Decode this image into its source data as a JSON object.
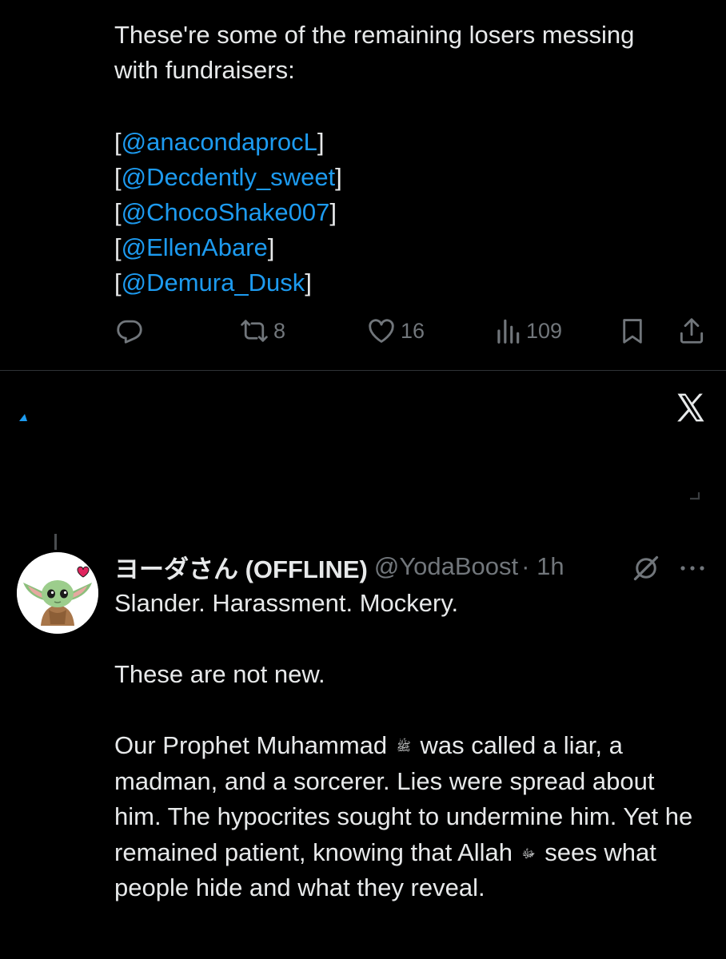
{
  "first_tweet": {
    "text_lines": [
      "These're some of the remaining losers messing",
      "with fundraisers:"
    ],
    "mentions": [
      "@anacondaprocL",
      "@Decdently_sweet",
      "@ChocoShake007",
      "@EllenAbare",
      "@Demura_Dusk"
    ],
    "actions": {
      "reply_count": "",
      "repost_count": "8",
      "like_count": "16",
      "views_count": "109"
    }
  },
  "second_tweet": {
    "display_name": "ヨーダさん (OFFLINE)",
    "handle": "@YodaBoost",
    "time": "· 1h",
    "paragraphs": {
      "p1": "Slander. Harassment. Mockery.",
      "p2": "These are not new.",
      "p3_before": "Our Prophet Muhammad",
      "p3_honorific_1": "ﷺ",
      "p3_middle": "was called a liar, a madman, and a sorcerer. Lies were spread about him. The hypocrites sought to undermine him. Yet he remained patient, knowing that Allah",
      "p3_honorific_2": "ﷻ",
      "p3_after": "sees what people hide and what they reveal."
    }
  },
  "icons": {
    "reply": "reply-icon",
    "repost": "repost-icon",
    "like": "heart-icon",
    "views": "views-chart-icon",
    "bookmark": "bookmark-icon",
    "share": "share-icon",
    "x_logo": "x-logo-icon",
    "grok": "grok-icon",
    "more": "more-dots-icon",
    "avatar": "baby-yoda-avatar"
  },
  "colors": {
    "background": "#000000",
    "text": "#e7e9ea",
    "secondary": "#71767b",
    "link": "#1d9bf0",
    "heart_badge": "#e0245e"
  }
}
